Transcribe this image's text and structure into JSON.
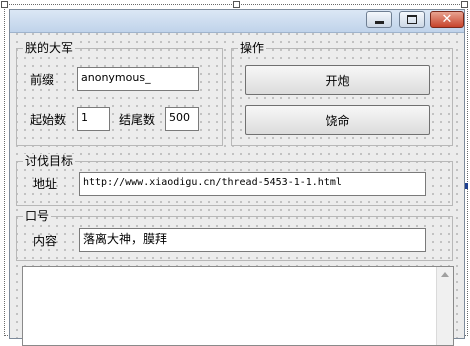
{
  "window": {
    "min_icon": "minimize-icon",
    "max_icon": "maximize-icon",
    "close_icon": "close-icon",
    "close_glyph": "✕"
  },
  "group_main": {
    "legend": "朕的大军",
    "prefix_label": "前缀",
    "prefix_value": "anonymous_",
    "start_label": "起始数",
    "start_value": "1",
    "end_label": "结尾数",
    "end_value": "500"
  },
  "group_ops": {
    "legend": "操作",
    "fire_label": "开炮",
    "spare_label": "饶命"
  },
  "group_target": {
    "legend": "讨伐目标",
    "address_label": "地址",
    "address_value": "http://www.xiaodigu.cn/thread-5453-1-1.html"
  },
  "group_slogan": {
    "legend": "口号",
    "content_label": "内容",
    "content_value": "落离大神，膜拜"
  }
}
